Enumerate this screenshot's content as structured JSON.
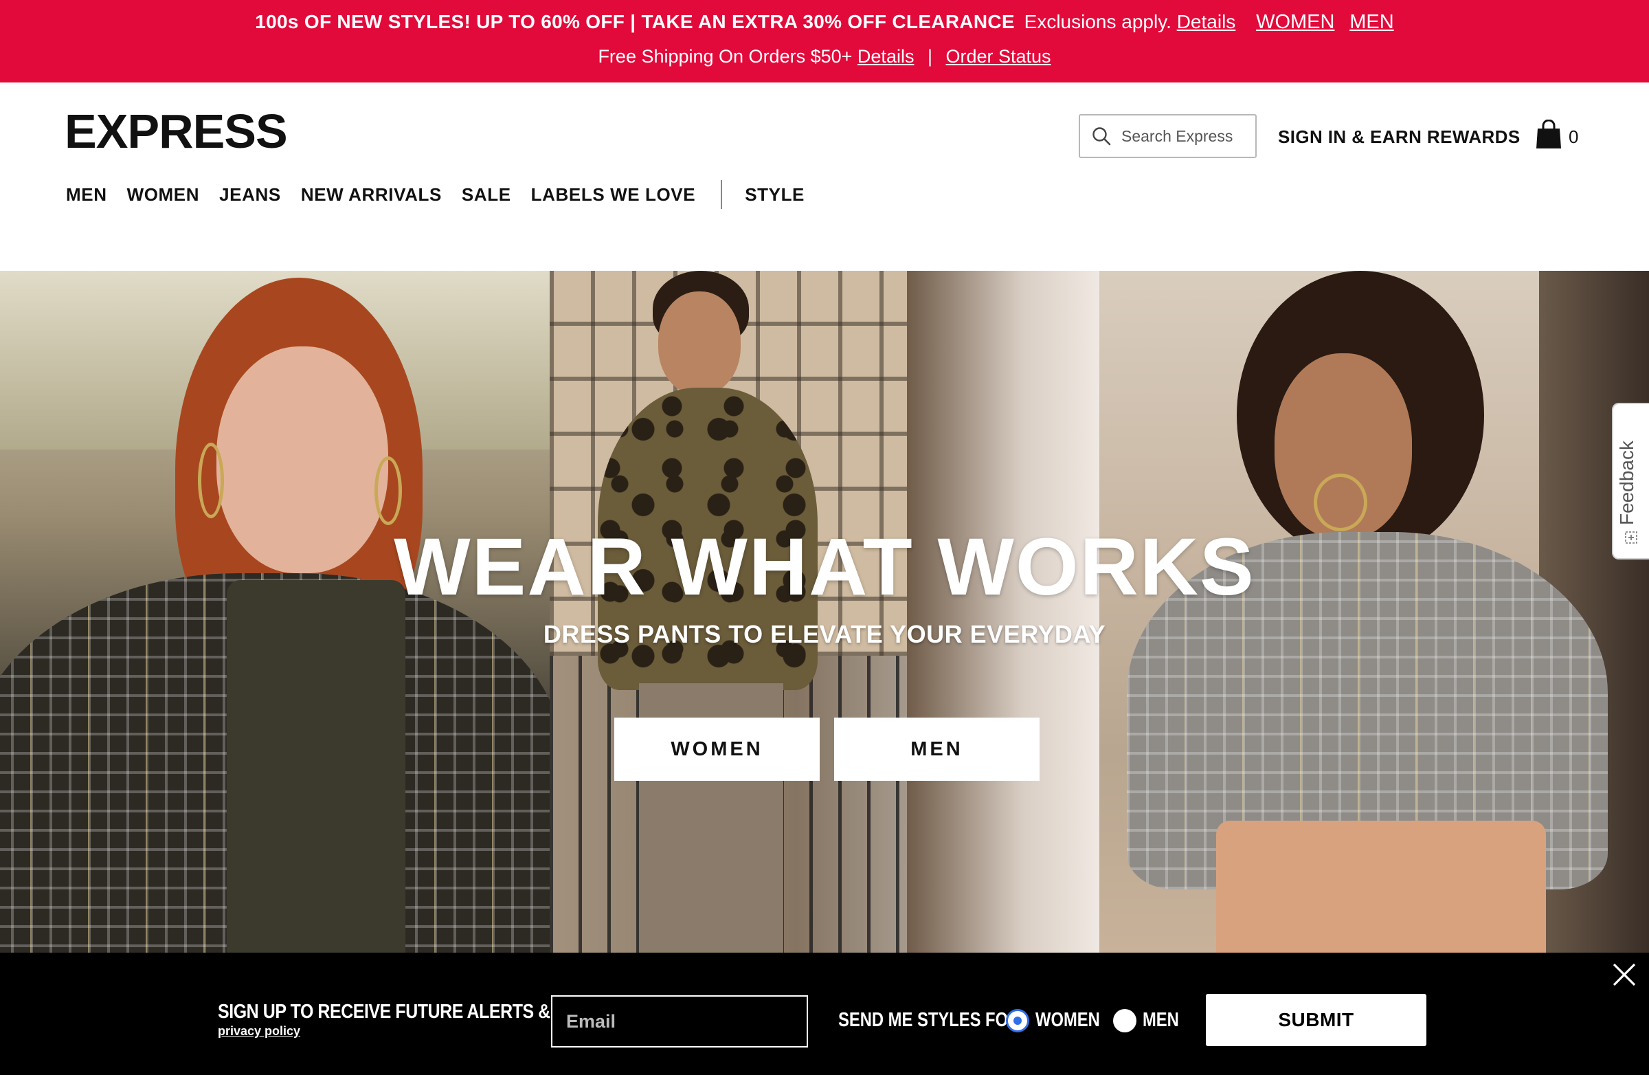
{
  "promo": {
    "headline": "100s OF NEW STYLES! UP TO 60% OFF | TAKE AN EXTRA 30% OFF CLEARANCE",
    "note": "Exclusions apply.",
    "details_link": "Details",
    "women_link": "WOMEN",
    "men_link": "MEN",
    "shipping_text": "Free Shipping On Orders $50+",
    "shipping_details_link": "Details",
    "separator": "|",
    "order_status_link": "Order Status"
  },
  "header": {
    "logo": "EXPRESS",
    "search_placeholder": "Search Express",
    "signin": "SIGN IN & EARN REWARDS",
    "bag_count": "0",
    "icons": {
      "search": "search-icon",
      "bag": "shopping-bag-icon"
    }
  },
  "nav": {
    "items": [
      "MEN",
      "WOMEN",
      "JEANS",
      "NEW ARRIVALS",
      "SALE",
      "LABELS WE LOVE"
    ],
    "style": "STYLE"
  },
  "hero": {
    "title": "WEAR WHAT WORKS",
    "subtitle": "DRESS PANTS TO ELEVATE YOUR EVERYDAY",
    "women_button": "WOMEN",
    "men_button": "MEN"
  },
  "feedback": {
    "label": "Feedback",
    "icon": "plus-box-icon"
  },
  "signup": {
    "title": "SIGN UP TO RECEIVE FUTURE ALERTS & OFFERS",
    "privacy": "privacy policy",
    "email_placeholder": "Email",
    "styles_for": "SEND ME STYLES FOR",
    "option_women": "WOMEN",
    "option_men": "MEN",
    "selected": "WOMEN",
    "submit": "SUBMIT",
    "close_icon": "close-icon"
  },
  "colors": {
    "promo_bar": "#e20a3b",
    "signup_bar": "#000000",
    "radio_selected": "#2f6fe8"
  }
}
